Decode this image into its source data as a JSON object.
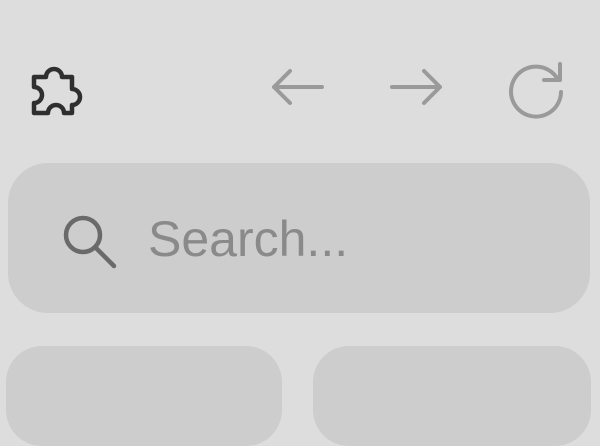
{
  "toolbar": {
    "icons": {
      "extensions": "puzzle-piece-icon",
      "back": "arrow-left-icon",
      "forward": "arrow-right-icon",
      "reload": "reload-icon"
    }
  },
  "search": {
    "placeholder": "Search...",
    "icon": "search-icon"
  },
  "colors": {
    "background": "#dddddd",
    "surface": "#cdcdcd",
    "icon_active": "#2f2f2f",
    "icon_muted": "#9a9a9a",
    "placeholder_text": "#8a8a8a"
  }
}
